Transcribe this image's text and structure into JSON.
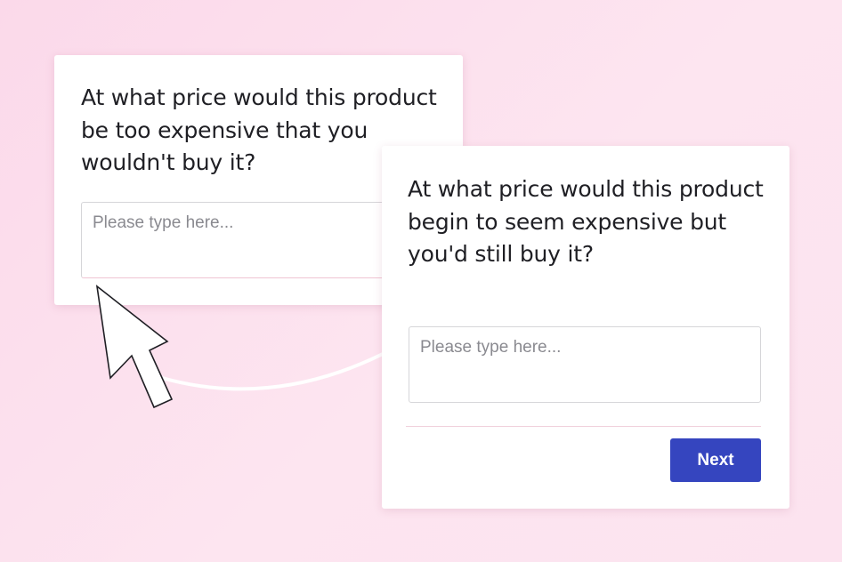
{
  "survey": {
    "card_back": {
      "question": "At what price would this product be too expensive that you wouldn't buy it?",
      "answer_placeholder": "Please type here..."
    },
    "card_front": {
      "question": "At what price would this product begin to seem expensive but you'd still buy it?",
      "answer_placeholder": "Please type here...",
      "next_label": "Next"
    }
  },
  "decorations": {
    "pointer": "mouse-pointer-icon",
    "connector": "curved-arrow-line"
  },
  "colors": {
    "background": "#fcdfee",
    "card": "#ffffff",
    "accent_button": "#3545bf",
    "text": "#1f1f24",
    "placeholder": "#8a8a90"
  }
}
